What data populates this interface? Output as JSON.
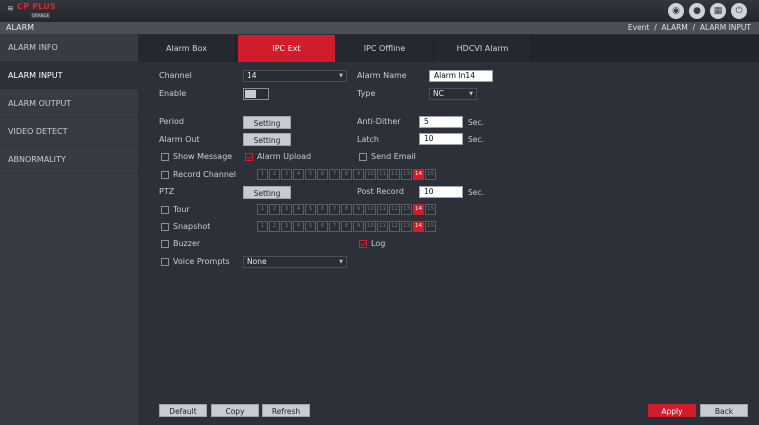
{
  "brand": {
    "name": "CP PLUS",
    "sub": "ORANGE"
  },
  "header": {
    "title": "ALARM",
    "breadcrumb": [
      "Event",
      "ALARM",
      "ALARM INPUT"
    ],
    "separator": "/"
  },
  "top_icons": [
    "eye-icon",
    "user-icon",
    "grid-icon",
    "power-icon"
  ],
  "sidebar": {
    "items": [
      {
        "label": "ALARM INFO"
      },
      {
        "label": "ALARM INPUT"
      },
      {
        "label": "ALARM OUTPUT"
      },
      {
        "label": "VIDEO DETECT"
      },
      {
        "label": "ABNORMALITY"
      }
    ],
    "active_index": 1
  },
  "tabs": [
    {
      "label": "Alarm Box"
    },
    {
      "label": "IPC Ext"
    },
    {
      "label": "IPC Offline"
    },
    {
      "label": "HDCVI Alarm"
    }
  ],
  "form": {
    "channel_label": "Channel",
    "channel_value": "14",
    "alarm_name_label": "Alarm Name",
    "alarm_name_value": "Alarm In14",
    "enable_label": "Enable",
    "type_label": "Type",
    "type_value": "NC",
    "period_label": "Period",
    "period_button": "Setting",
    "anti_dither_label": "Anti-Dither",
    "anti_dither_value": "5",
    "anti_dither_unit": "Sec.",
    "alarm_out_label": "Alarm Out",
    "alarm_out_button": "Setting",
    "latch_label": "Latch",
    "latch_value": "10",
    "latch_unit": "Sec.",
    "show_message_label": "Show Message",
    "alarm_upload_label": "Alarm Upload",
    "send_email_label": "Send Email",
    "record_channel_label": "Record Channel",
    "ptz_label": "PTZ",
    "ptz_button": "Setting",
    "post_record_label": "Post Record",
    "post_record_value": "10",
    "post_record_unit": "Sec.",
    "tour_label": "Tour",
    "snapshot_label": "Snapshot",
    "buzzer_label": "Buzzer",
    "log_label": "Log",
    "voice_prompts_label": "Voice Prompts",
    "voice_prompts_value": "None"
  },
  "channels": [
    "1",
    "2",
    "3",
    "4",
    "5",
    "6",
    "7",
    "8",
    "9",
    "10",
    "11",
    "12",
    "13",
    "14",
    "15"
  ],
  "selected_channel": "14",
  "footer": {
    "default": "Default",
    "copy": "Copy",
    "refresh": "Refresh",
    "apply": "Apply",
    "back": "Back"
  },
  "colors": {
    "accent": "#d21c2c",
    "background": "#2c3038",
    "sidebar": "#373b43"
  }
}
